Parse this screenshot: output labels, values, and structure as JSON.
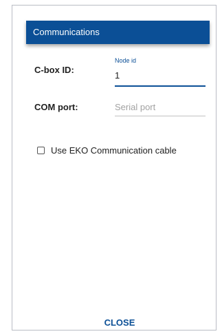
{
  "dialog": {
    "title": "Communications",
    "close_label": "CLOSE"
  },
  "cbox_id": {
    "label": "C-box ID:",
    "floating_label": "Node id",
    "value": "1"
  },
  "com_port": {
    "label": "COM port:",
    "placeholder": "Serial port",
    "value": ""
  },
  "eko_cable": {
    "label": "Use EKO Communication cable",
    "checked": false
  },
  "colors": {
    "accent": "#0b4f96",
    "text": "#202020",
    "placeholder": "#a2a2a2"
  }
}
